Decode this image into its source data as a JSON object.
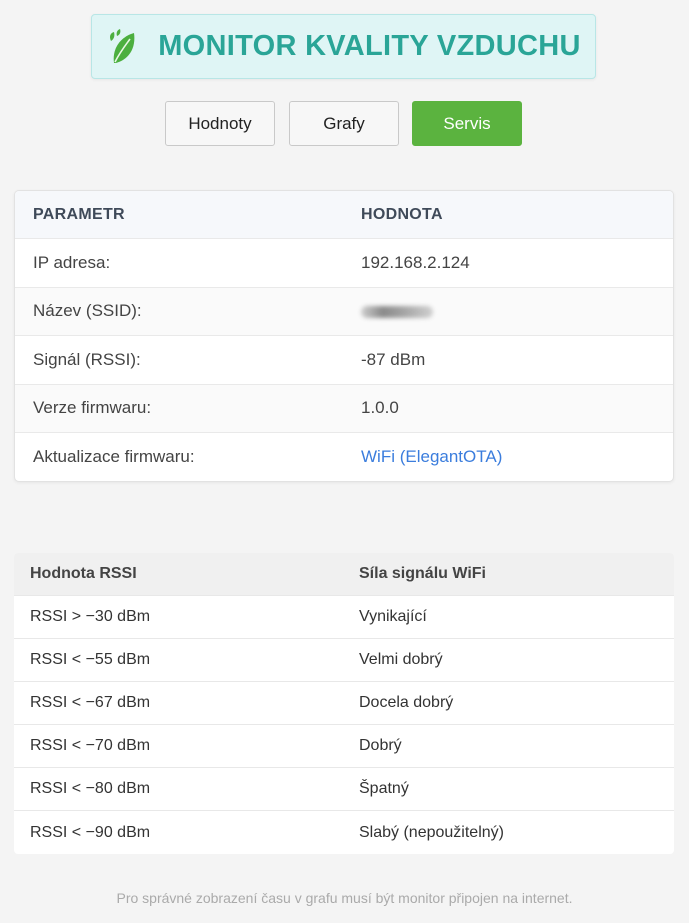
{
  "header": {
    "title": "MONITOR KVALITY VZDUCHU",
    "icon": "leaf-icon",
    "accent": "#2aa597"
  },
  "nav": {
    "buttons": [
      {
        "label": "Hodnoty",
        "active": false
      },
      {
        "label": "Grafy",
        "active": false
      },
      {
        "label": "Servis",
        "active": true
      }
    ],
    "active_color": "#5bb33f"
  },
  "info_table": {
    "headers": [
      "PARAMETR",
      "HODNOTA"
    ],
    "rows": [
      {
        "param": "IP adresa:",
        "value": "192.168.2.124"
      },
      {
        "param": "Název (SSID):",
        "value": ""
      },
      {
        "param": "Signál (RSSI):",
        "value": "-87 dBm"
      },
      {
        "param": "Verze firmwaru:",
        "value": "1.0.0"
      },
      {
        "param": "Aktualizace firmwaru:",
        "value": "WiFi (ElegantOTA)"
      }
    ]
  },
  "rssi_table": {
    "headers": [
      "Hodnota RSSI",
      "Síla signálu WiFi"
    ],
    "rows": [
      {
        "rssi": "RSSI > −30 dBm",
        "quality": "Vynikající"
      },
      {
        "rssi": "RSSI < −55 dBm",
        "quality": "Velmi dobrý"
      },
      {
        "rssi": "RSSI < −67 dBm",
        "quality": "Docela dobrý"
      },
      {
        "rssi": "RSSI < −70 dBm",
        "quality": "Dobrý"
      },
      {
        "rssi": "RSSI < −80 dBm",
        "quality": "Špatný"
      },
      {
        "rssi": "RSSI < −90 dBm",
        "quality": "Slabý (nepoužitelný)"
      }
    ]
  },
  "footer": {
    "note": "Pro správné zobrazení času v grafu musí být monitor připojen na internet."
  }
}
